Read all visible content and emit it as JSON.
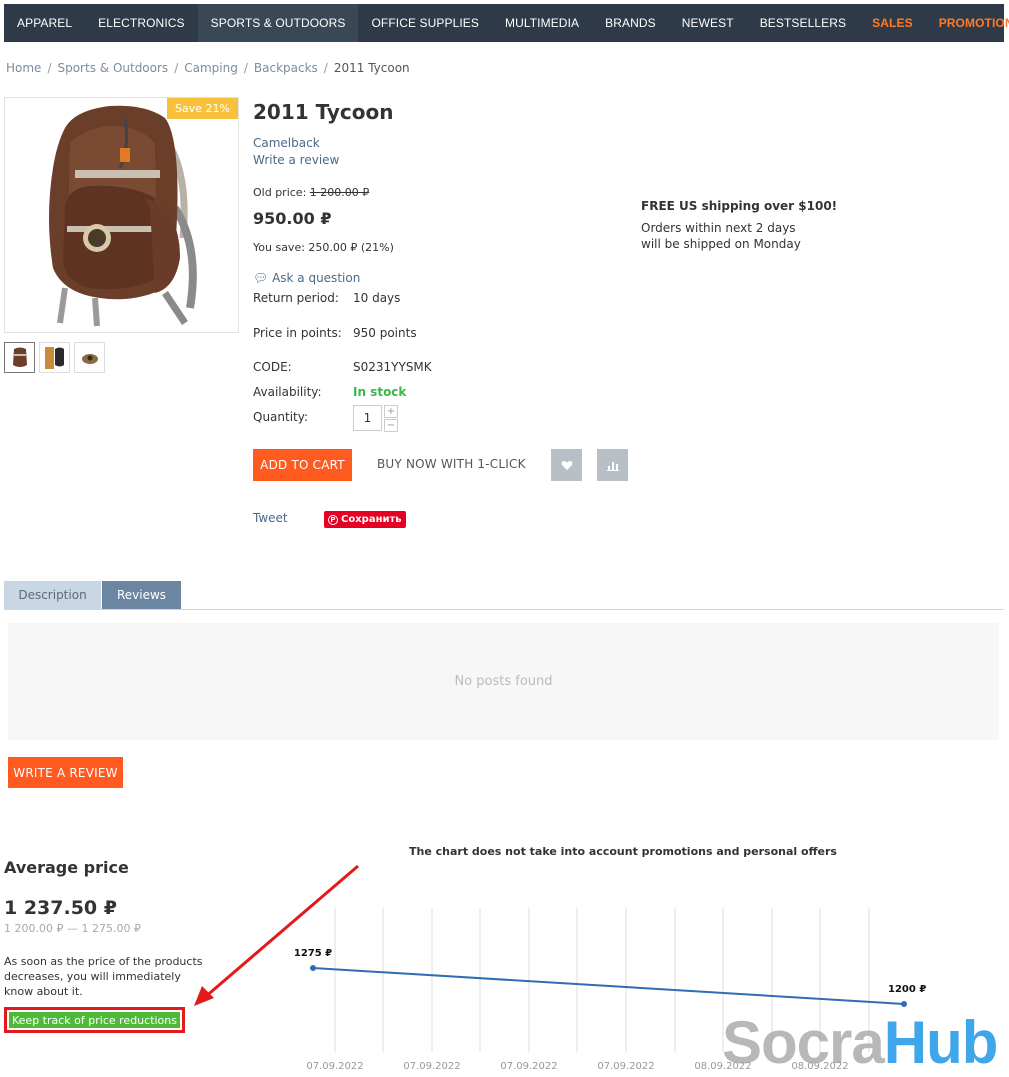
{
  "nav": {
    "items": [
      "APPAREL",
      "ELECTRONICS",
      "SPORTS & OUTDOORS",
      "OFFICE SUPPLIES",
      "MULTIMEDIA",
      "BRANDS",
      "NEWEST",
      "BESTSELLERS",
      "SALES",
      "PROMOTIONS"
    ],
    "active": "SPORTS & OUTDOORS",
    "accent_color": "#ff7a2b"
  },
  "breadcrumb": [
    "Home",
    "Sports & Outdoors",
    "Camping",
    "Backpacks",
    "2011 Tycoon"
  ],
  "product": {
    "name": "2011 Tycoon",
    "save_badge": "Save 21%",
    "brand": "Camelback",
    "write_review": "Write a review",
    "old_price_label": "Old price:",
    "old_price": "1 200.00 ₽",
    "price": "950.00 ₽",
    "you_save": "You save: 250.00 ₽ (21%)",
    "ask_question": "Ask a question",
    "return_label": "Return period:",
    "return_value": "10 days",
    "points_label": "Price in points:",
    "points_value": "950 points",
    "code_label": "CODE:",
    "code_value": "S0231YYSMK",
    "availability_label": "Availability:",
    "availability_value": "In stock",
    "quantity_label": "Quantity:",
    "quantity_value": "1",
    "add_to_cart": "ADD TO CART",
    "buy_1click": "BUY NOW WITH 1-CLICK",
    "tweet": "Tweet",
    "pin_save": "Сохранить"
  },
  "shipping": {
    "title": "FREE US shipping over $100!",
    "text": "Orders within next 2 days will be shipped on Monday"
  },
  "tabs": [
    "Description",
    "Reviews"
  ],
  "active_tab": "Reviews",
  "reviews": {
    "empty": "No posts found",
    "write_button": "WRITE A REVIEW"
  },
  "average_price": {
    "title": "Average price",
    "value": "1 237.50 ₽",
    "range": "1 200.00 ₽ — 1 275.00 ₽",
    "note": "As soon as the price of the products decreases, you will immediately know about it.",
    "track_button": "Keep track of price reductions"
  },
  "chart_note": "The chart does not take into account promotions and personal offers",
  "chart_data": {
    "type": "line",
    "x_ticks": [
      "07.09.2022",
      "07.09.2022",
      "07.09.2022",
      "07.09.2022",
      "08.09.2022",
      "08.09.2022"
    ],
    "points": [
      {
        "value": 1275,
        "label": "1275 ₽"
      },
      {
        "value": 1200,
        "label": "1200 ₽"
      }
    ],
    "grid": true,
    "line_color": "#2f6db5"
  },
  "watermark": {
    "part1": "Socra",
    "part2": "Hub"
  }
}
